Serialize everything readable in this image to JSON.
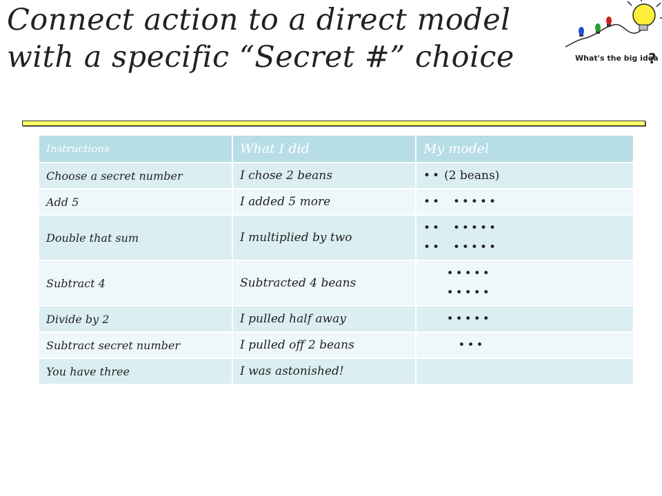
{
  "title": {
    "line1": "Connect action to a direct model",
    "line2": "with a specific “Secret #” choice"
  },
  "logo": {
    "text": "What's the big idea",
    "question_mark": "?",
    "icon": "lightbulb-icon"
  },
  "colors": {
    "header_bg": "#b7dde6",
    "row_odd": "#dbeef2",
    "row_even": "#eef7f9",
    "rule": "#ffff66"
  },
  "table": {
    "headers": [
      "Instructions",
      "What I did",
      "My model"
    ],
    "rows": [
      {
        "instruction": "Choose a secret number",
        "did": "I chose 2 beans",
        "model": [
          "••"
        ],
        "model_label": "(2 beans)"
      },
      {
        "instruction": "Add 5",
        "did": "I added 5 more",
        "model": [
          "••  •••••"
        ]
      },
      {
        "instruction": "Double that sum",
        "did": "I multiplied by two",
        "model": [
          "••  •••••",
          "••  •••••"
        ]
      },
      {
        "instruction": "Subtract 4",
        "did": "Subtracted 4 beans",
        "model": [
          "    •••••",
          "    •••••"
        ]
      },
      {
        "instruction": "Divide by 2",
        "did": "I pulled half away",
        "model": [
          "    •••••"
        ]
      },
      {
        "instruction": "Subtract secret number",
        "did": "I pulled off 2 beans",
        "model": [
          "      •••"
        ]
      },
      {
        "instruction": "You have three",
        "did": "I was astonished!",
        "model": []
      }
    ]
  }
}
